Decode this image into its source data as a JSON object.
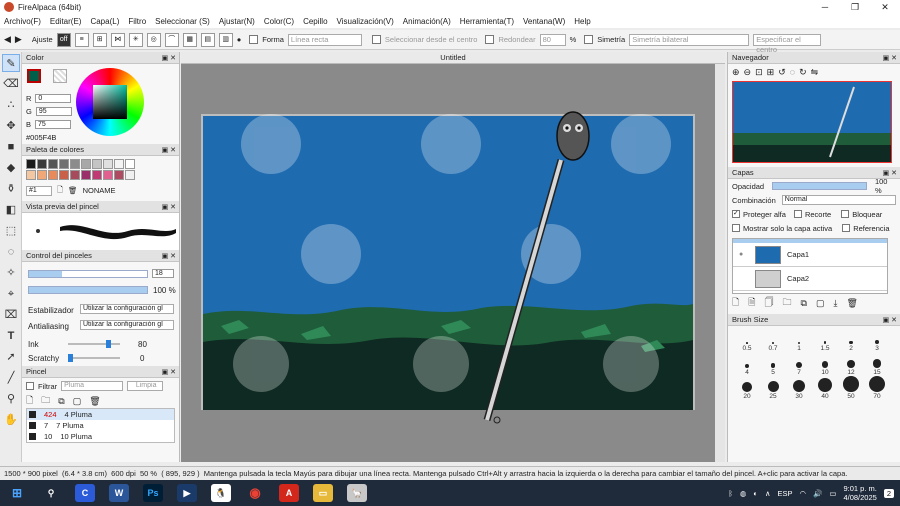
{
  "window": {
    "title": "FireAlpaca (64bit)"
  },
  "menu": [
    "Archivo(F)",
    "Editar(E)",
    "Capa(L)",
    "Filtro",
    "Seleccionar (S)",
    "Ajustar(N)",
    "Color(C)",
    "Cepillo",
    "Visualización(V)",
    "Animación(A)",
    "Herramienta(T)",
    "Ventana(W)",
    "Help"
  ],
  "toolbar": {
    "ajuste_label": "Ajuste",
    "snap_off": "off",
    "forma_label": "Forma",
    "forma_value": "Línea recta",
    "select_center_label": "Seleccionar desde el centro",
    "round_label": "Redondear",
    "round_value": "80",
    "round_unit": "%",
    "symmetry_label": "Simetría",
    "symmetry_value": "Simetría bilateral",
    "spec_center_label": "Especificar el centro"
  },
  "color_panel": {
    "title": "Color",
    "r_label": "R",
    "r_value": "0",
    "g_label": "G",
    "g_value": "95",
    "b_label": "B",
    "b_value": "75",
    "hex": "#005F4B",
    "current_color": "#005f4b"
  },
  "palette_panel": {
    "title": "Paleta de colores",
    "index": "#1",
    "name": "NONAME",
    "row1": [
      "#1a1a1a",
      "#3a3a3a",
      "#555555",
      "#707070",
      "#8c8c8c",
      "#a8a8a8",
      "#c4c4c4",
      "#e0e0e0",
      "#f4f4f4",
      "#ffffff"
    ],
    "row2": [
      "#f4c7a3",
      "#f0a878",
      "#e88a5a",
      "#c8604a",
      "#a64a5c",
      "#9a2f6a",
      "#c23a74",
      "#e06090",
      "#b04a60",
      "#f0f0f0"
    ]
  },
  "brush_preview": {
    "title": "Vista previa del pincel"
  },
  "brush_control": {
    "title": "Control del pinceles",
    "size_value": "18",
    "size_fill": 0.28,
    "opacity_value": "100 %",
    "opacity_fill": 1.0,
    "stabilizer_label": "Estabilizador",
    "stabilizer_value": "Utilizar la configuración gl",
    "antialias_label": "Antialiasing",
    "antialias_value": "Utilizar la configuración gl",
    "ink_label": "Ink",
    "ink_value": "80",
    "ink_fill": 0.8,
    "scratchy_label": "Scratchy",
    "scratchy_value": "0"
  },
  "brush_panel": {
    "title": "Pincel",
    "filter_label": "Filtrar",
    "filter_placeholder": "Pluma",
    "clear_label": "Limpia",
    "items": [
      {
        "size": "424",
        "name": "4 Pluma"
      },
      {
        "size": "7",
        "name": "7 Pluma"
      },
      {
        "size": "10",
        "name": "10 Pluma"
      }
    ]
  },
  "canvas": {
    "title": "Untitled"
  },
  "navigator": {
    "title": "Navegador"
  },
  "layers_panel": {
    "title": "Capas",
    "opacity_label": "Opacidad",
    "opacity_value": "100 %",
    "opacity_fill": 1.0,
    "blend_label": "Combinación",
    "blend_value": "Normal",
    "protect_alpha": "Proteger alfa",
    "clip": "Recorte",
    "lock": "Bloquear",
    "show_active_only": "Mostrar solo la capa activa",
    "reference": "Referencia",
    "layers": [
      {
        "name": "Capa1",
        "thumb_color": "#1f6bb0"
      },
      {
        "name": "Capa2",
        "thumb_color": "#cfcfcf"
      }
    ]
  },
  "brush_size_panel": {
    "title": "Brush Size",
    "sizes": [
      "0.5",
      "0.7",
      "1",
      "1.5",
      "2",
      "3",
      "4",
      "5",
      "7",
      "10",
      "12",
      "15",
      "20",
      "25",
      "30",
      "40",
      "50",
      "70"
    ]
  },
  "status": {
    "canvas_size": "1500 * 900 pixel",
    "print_size": "(6.4 * 3.8 cm)",
    "dpi": "600 dpi",
    "zoom": "50 %",
    "coords": "( 895, 929 )",
    "hint": "Mantenga pulsada la tecla Mayús para dibujar una línea recta. Mantenga pulsado Ctrl+Alt y arrastra hacia la izquierda o la derecha para cambiar el tamaño del pincel. A+clic para activar la capa."
  },
  "taskbar": {
    "lang": "ESP",
    "time": "9:01 p. m.",
    "date": "4/08/2025",
    "notifications": "2"
  },
  "colors": {
    "sky": "#1f6bb0",
    "grass": "#1f5c3a",
    "ground": "#0e2a22",
    "accent": "#a8cdef"
  }
}
